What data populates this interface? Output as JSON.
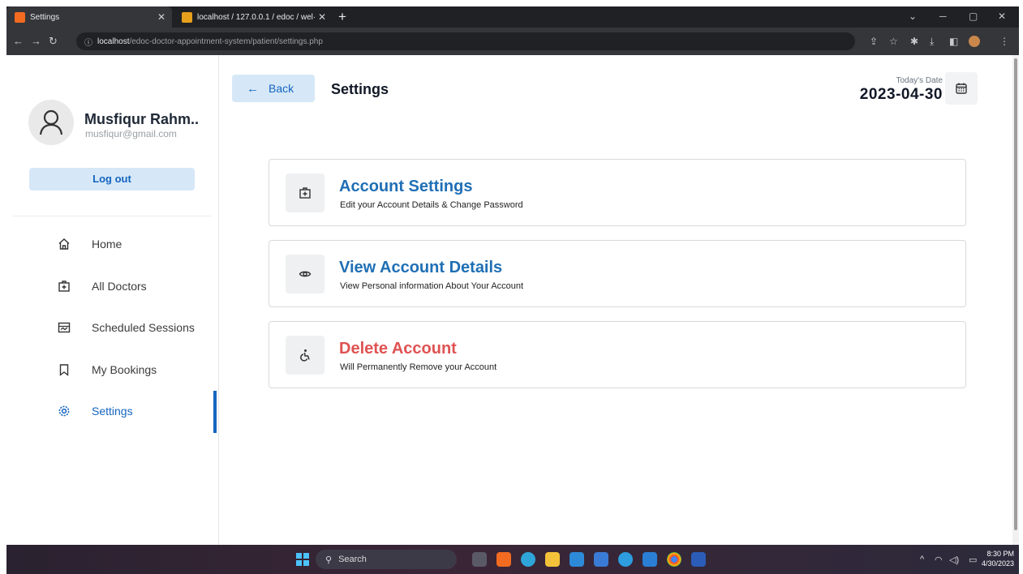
{
  "browser": {
    "tabs": [
      {
        "title": "Settings",
        "icon": "xampp-app-icon",
        "active": true
      },
      {
        "title": "localhost / 127.0.0.1 / edoc / wel·",
        "icon": "phpmyadmin-icon",
        "active": false
      }
    ],
    "new_tab_label": "+",
    "url_host": "localhost",
    "url_path": "/edoc-doctor-appointment-system/patient/settings.php"
  },
  "sidebar": {
    "user_name": "Musfiqur Rahm..",
    "user_email": "musfiqur@gmail.com",
    "logout_label": "Log out",
    "items": [
      {
        "label": "Home",
        "icon": "home-icon"
      },
      {
        "label": "All Doctors",
        "icon": "doctor-icon"
      },
      {
        "label": "Scheduled Sessions",
        "icon": "sessions-icon"
      },
      {
        "label": "My Bookings",
        "icon": "bookmark-icon"
      },
      {
        "label": "Settings",
        "icon": "gear-icon",
        "active": true
      }
    ]
  },
  "header": {
    "back_label": "Back",
    "title": "Settings",
    "date_label": "Today's Date",
    "date_value": "2023-04-30"
  },
  "cards": [
    {
      "title": "Account Settings",
      "subtitle": "Edit your Account Details & Change Password",
      "icon": "doctor-icon"
    },
    {
      "title": "View Account Details",
      "subtitle": "View Personal information About Your Account",
      "icon": "eye-icon"
    },
    {
      "title": "Delete Account",
      "subtitle": "Will Permanently Remove your Account",
      "icon": "accessibility-icon",
      "danger": true
    }
  ],
  "taskbar": {
    "search_label": "Search",
    "time": "8:30 PM",
    "date": "4/30/2023"
  },
  "colors": {
    "accent": "#1565c0",
    "card_title": "#1f6fb5",
    "danger": "#e05252",
    "button_bg": "#d6e8f7"
  }
}
